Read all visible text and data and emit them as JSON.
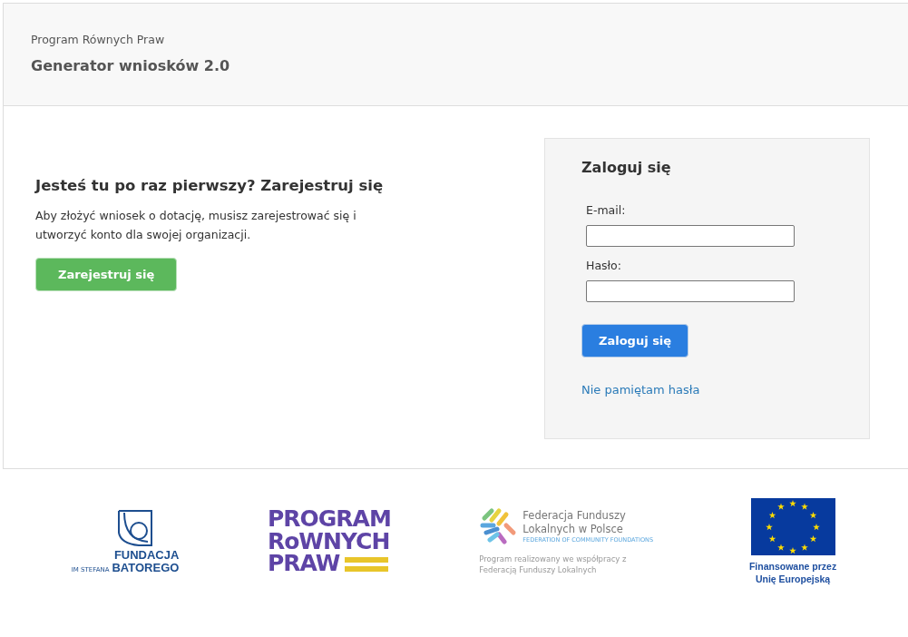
{
  "header": {
    "subtitle": "Program Równych Praw",
    "title": "Generator wniosków 2.0"
  },
  "register": {
    "heading": "Jesteś tu po raz pierwszy? Zarejestruj się",
    "text": "Aby złożyć wniosek o dotację, musisz zarejestrować się i utworzyć konto dla swojej organizacji.",
    "button": "Zarejestruj się"
  },
  "login": {
    "heading": "Zaloguj się",
    "fields": [
      {
        "label": "E-mail:"
      },
      {
        "label": "Hasło:"
      }
    ],
    "button": "Zaloguj się",
    "forgot_link": "Nie pamiętam hasła"
  },
  "footer": {
    "logos": [
      {
        "kind": "batory",
        "lines": [
          "FUNDACJA",
          "BATOREGO"
        ],
        "small": "IM STEFANA"
      },
      {
        "kind": "prp",
        "lines": [
          "PROGRAM",
          "RoWNYCH",
          "PRAW"
        ]
      },
      {
        "kind": "ffl",
        "lines": [
          "Federacja Funduszy",
          "Lokalnych w Polsce"
        ],
        "small": "FEDERATION OF COMMUNITY FOUNDATIONS",
        "caption": "Program realizowany we współpracy z Federacją Funduszy Lokalnych"
      },
      {
        "kind": "eu",
        "lines": [
          "Finansowane przez",
          "Unię Europejską"
        ]
      }
    ]
  }
}
